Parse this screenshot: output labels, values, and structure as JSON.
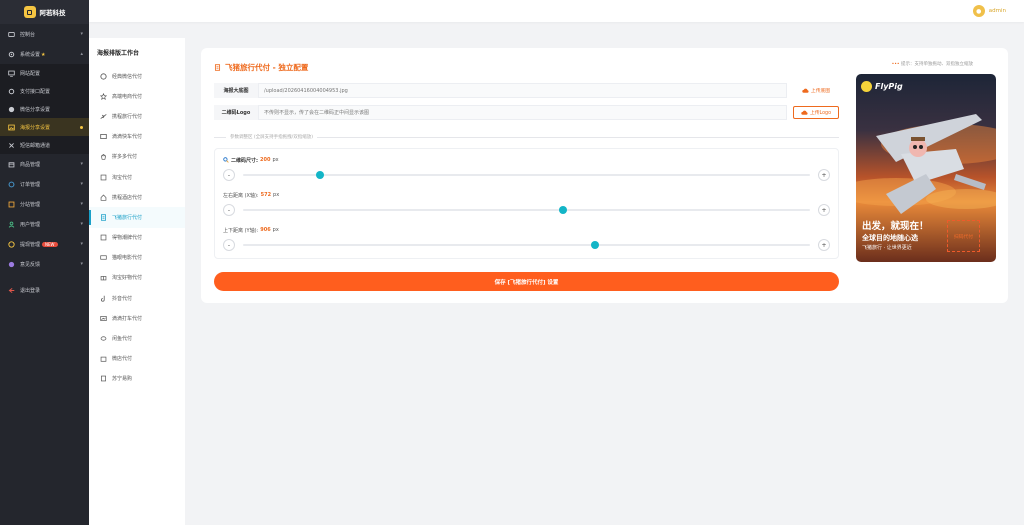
{
  "brand": {
    "name": "阿若科技"
  },
  "sidebar": {
    "items": [
      {
        "label": "控制台",
        "icon": "dashboard-icon",
        "arrow": "▾"
      },
      {
        "label": "系统设置",
        "icon": "gear-icon",
        "arrow": "▴",
        "star": "★"
      },
      {
        "label": "网站配置",
        "icon": "monitor-icon",
        "sub": true
      },
      {
        "label": "支付接口配置",
        "icon": "gear-icon",
        "sub": true
      },
      {
        "label": "微信分享设置",
        "icon": "wechat-icon",
        "sub": true
      },
      {
        "label": "海报分享设置",
        "icon": "image-icon",
        "sub": true,
        "active": true
      },
      {
        "label": "短信邮箱通道",
        "icon": "tools-icon",
        "sub": true
      },
      {
        "label": "商品管理",
        "icon": "box-icon",
        "arrow": "▾"
      },
      {
        "label": "订单管理",
        "icon": "order-icon",
        "arrow": "▾"
      },
      {
        "label": "分站管理",
        "icon": "site-icon",
        "arrow": "▾"
      },
      {
        "label": "用户管理",
        "icon": "user-icon",
        "arrow": "▾"
      },
      {
        "label": "提现管理",
        "icon": "withdraw-icon",
        "arrow": "▾",
        "badge": "NEW"
      },
      {
        "label": "意见反馈",
        "icon": "feedback-icon",
        "arrow": "▾"
      },
      {
        "label": "退出登录",
        "icon": "logout-icon"
      }
    ]
  },
  "topbar": {
    "user": "admin"
  },
  "subnav": {
    "title": "海报排版工作台",
    "items": [
      {
        "label": "经典微信代付",
        "icon": "chat-icon"
      },
      {
        "label": "高端电商代付",
        "icon": "star-icon"
      },
      {
        "label": "携程旅行代付",
        "icon": "plane-icon"
      },
      {
        "label": "滴滴快车代付",
        "icon": "car-icon"
      },
      {
        "label": "拼多多代付",
        "icon": "shop-icon"
      },
      {
        "label": "淘宝代付",
        "icon": "taobao-icon"
      },
      {
        "label": "携程酒店代付",
        "icon": "hotel-icon"
      },
      {
        "label": "飞猪旅行代付",
        "icon": "doc-icon",
        "active": true
      },
      {
        "label": "得物潮牌代付",
        "icon": "tag-icon"
      },
      {
        "label": "猫眼电影代付",
        "icon": "ticket-icon"
      },
      {
        "label": "淘宝好物代付",
        "icon": "gift-icon"
      },
      {
        "label": "抖音代付",
        "icon": "music-icon"
      },
      {
        "label": "滴滴打车代付",
        "icon": "taxi-icon"
      },
      {
        "label": "闲鱼代付",
        "icon": "fish-icon"
      },
      {
        "label": "微店代付",
        "icon": "store-icon"
      },
      {
        "label": "苏宁易购",
        "icon": "cart-icon"
      }
    ]
  },
  "main": {
    "title": "飞猪旅行代付 - 独立配置",
    "tip": "提示：支持单独拖动、双指独立缩放",
    "poster_row": {
      "label": "海报大底图",
      "value": "/upload/20260416004004953.jpg",
      "button": "上传底图"
    },
    "logo_row": {
      "label": "二维码Logo",
      "value": "不传则不显示，传了会在二维码正中间显示该图",
      "button": "上传Logo"
    },
    "section_label": "参数调整区 (全屏支持手指拖拽/双指缩放)",
    "sliders": [
      {
        "label": "二维码尺寸:",
        "value": "200",
        "unit": "px",
        "fraction": 0.135
      },
      {
        "label": "左右距离 (X轴):",
        "value": "572",
        "unit": "px",
        "fraction": 0.565
      },
      {
        "label": "上下距离 (Y轴):",
        "value": "906",
        "unit": "px",
        "fraction": 0.62
      }
    ],
    "minus": "-",
    "plus": "+",
    "save": "保存 [飞猪旅行代付] 设置"
  },
  "poster": {
    "brand": "FlyPig",
    "headline": "出发，就现在！",
    "subline": "全球目的地随心选",
    "slogan": "飞猪旅行 · 让世界更近",
    "qr_placeholder": "扫码代付"
  },
  "colors": {
    "accent": "#ff5e1e",
    "slider": "#13b5c7",
    "sidebar": "#24262d",
    "gold": "#f5c542"
  }
}
